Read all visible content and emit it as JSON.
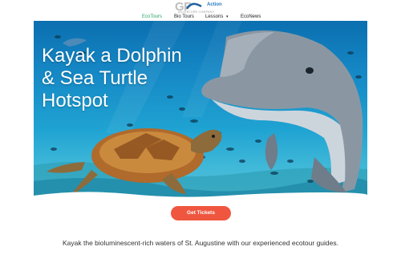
{
  "logo": {
    "mark": "GF",
    "tagline": "ADVENTURE COMPANY",
    "name": "Action",
    "alt": "GF Action Adventure Company"
  },
  "nav": {
    "items": [
      {
        "label": "EcoTours",
        "active": true
      },
      {
        "label": "Bio Tours",
        "active": false
      },
      {
        "label": "Lessons",
        "active": false,
        "has_dropdown": true
      },
      {
        "label": "EcoNews",
        "active": false
      }
    ]
  },
  "hero": {
    "title_lines": [
      "Kayak a Dolphin",
      "& Sea Turtle",
      "Hotspot"
    ],
    "image_subjects": [
      "dolphin",
      "sea turtle",
      "fish school",
      "coral reef"
    ]
  },
  "cta": {
    "label": "Get Tickets"
  },
  "description": "Kayak the bioluminescent-rich waters of St. Augustine with our experienced ecotour guides.",
  "colors": {
    "accent_green": "#2aa567",
    "cta_red": "#f0563f",
    "water_blue": "#1689c6"
  }
}
